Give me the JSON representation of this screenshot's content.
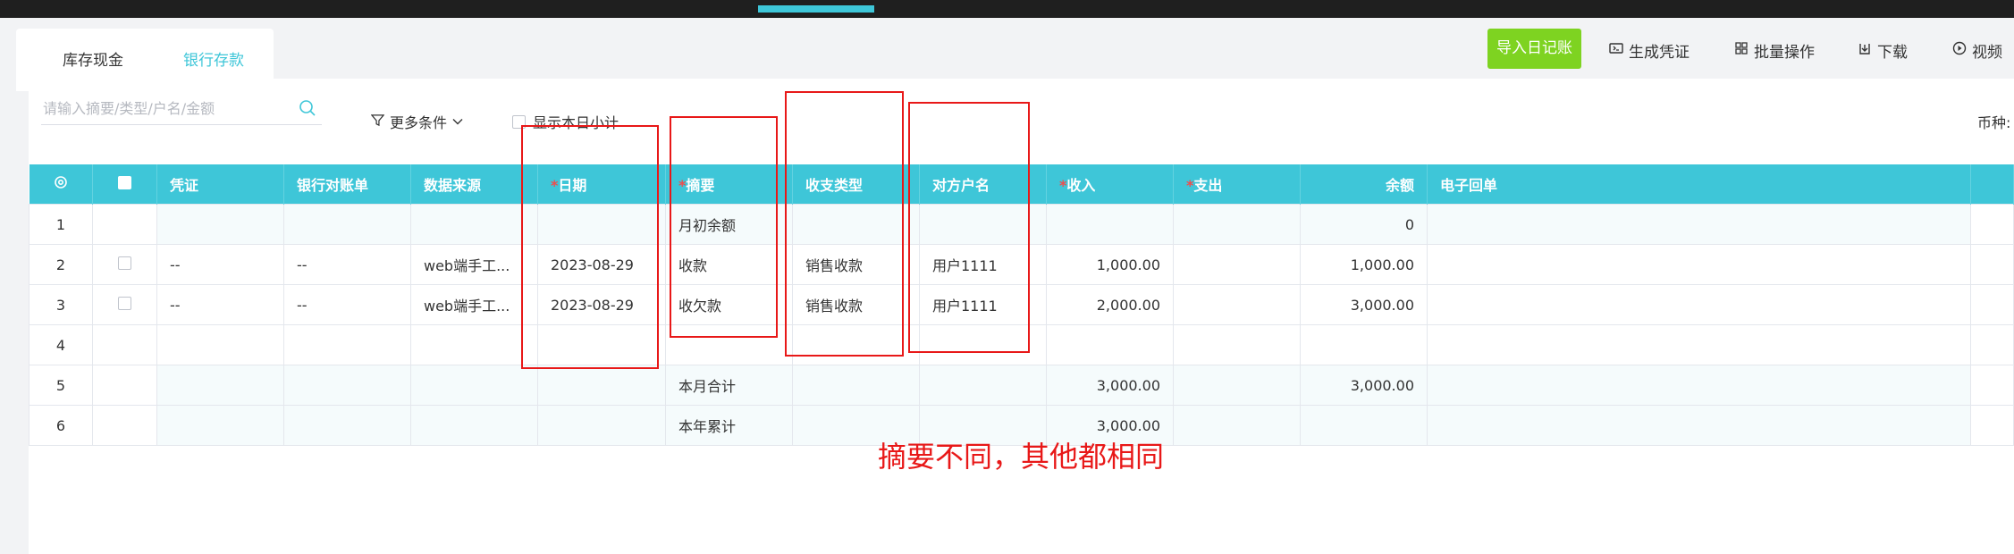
{
  "tabs": [
    {
      "label": "库存现金"
    },
    {
      "label": "银行存款"
    }
  ],
  "toolbar": {
    "import_label": "导入日记账",
    "voucher_label": "生成凭证",
    "batch_label": "批量操作",
    "download_label": "下载",
    "video_label": "视频"
  },
  "filters": {
    "search_placeholder": "请输入摘要/类型/户名/金额",
    "more_label": "更多条件",
    "show_day_label": "显示本日小计",
    "currency_label": "币种:"
  },
  "table": {
    "headers": {
      "voucher": "凭证",
      "bank_statement": "银行对账单",
      "data_source": "数据来源",
      "date": "日期",
      "summary": "摘要",
      "type": "收支类型",
      "counterparty": "对方户名",
      "income": "收入",
      "expense": "支出",
      "balance": "余额",
      "receipt": "电子回单"
    },
    "rows": [
      {
        "idx": "1",
        "summary": "月初余额",
        "balance": "0"
      },
      {
        "idx": "2",
        "voucher": "--",
        "bank_statement": "--",
        "data_source": "web端手工...",
        "date": "2023-08-29",
        "summary": "收款",
        "type": "销售收款",
        "counterparty": "用户1111",
        "income": "1,000.00",
        "balance": "1,000.00"
      },
      {
        "idx": "3",
        "voucher": "--",
        "bank_statement": "--",
        "data_source": "web端手工...",
        "date": "2023-08-29",
        "summary": "收欠款",
        "type": "销售收款",
        "counterparty": "用户1111",
        "income": "2,000.00",
        "balance": "3,000.00"
      },
      {
        "idx": "4"
      },
      {
        "idx": "5",
        "summary": "本月合计",
        "income": "3,000.00",
        "balance": "3,000.00"
      },
      {
        "idx": "6",
        "summary": "本年累计",
        "income": "3,000.00"
      }
    ]
  },
  "annotation": {
    "text": "摘要不同，其他都相同",
    "color": "#e81818"
  },
  "colors": {
    "accent": "#3ec6d8",
    "import_button": "#7ed321",
    "annotation": "#e81818"
  },
  "icons": [
    "search-icon",
    "filter-icon",
    "chevron-down-icon",
    "gear-icon",
    "voucher-icon",
    "batch-icon",
    "download-icon",
    "video-icon"
  ]
}
